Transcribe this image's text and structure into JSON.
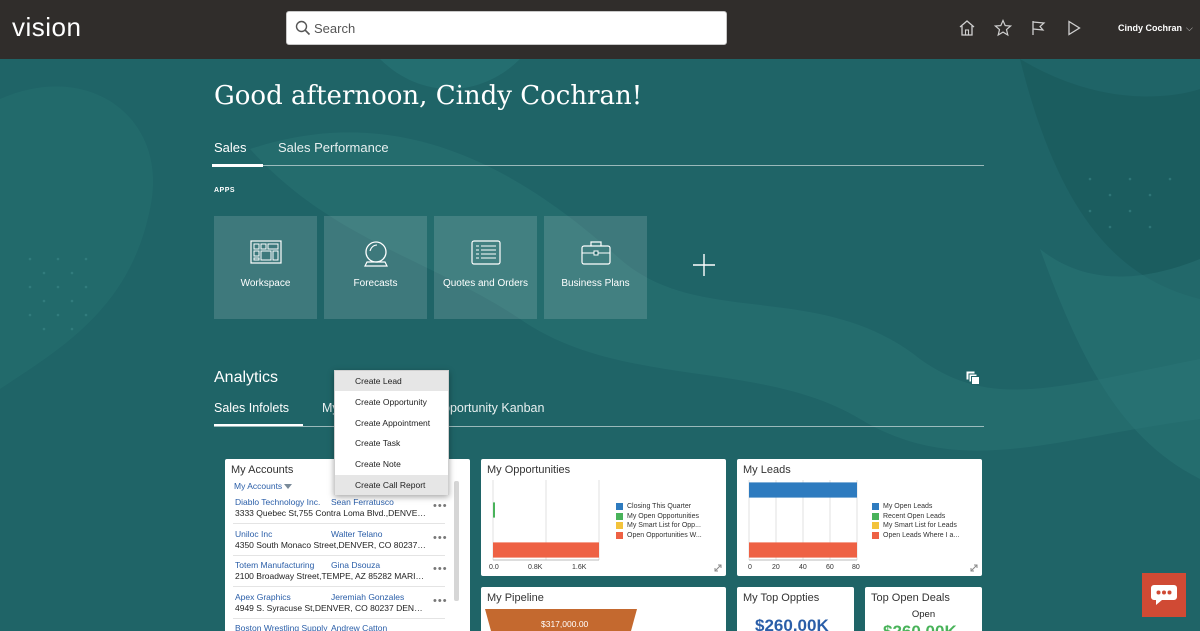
{
  "header": {
    "logo": "vision",
    "search_placeholder": "Search",
    "icons": [
      "home-icon",
      "star-icon",
      "flag-icon",
      "play-icon"
    ],
    "user_name": "Cindy Cochran",
    "user_chevron": "⌵"
  },
  "greeting": "Good afternoon, Cindy Cochran!",
  "tabs": [
    {
      "label": "Sales",
      "active": true
    },
    {
      "label": "Sales Performance",
      "active": false
    }
  ],
  "apps": {
    "label": "APPS",
    "items": [
      {
        "label": "Workspace",
        "icon": "workspace-icon"
      },
      {
        "label": "Forecasts",
        "icon": "forecasts-icon"
      },
      {
        "label": "Quotes and Orders",
        "icon": "quotes-icon"
      },
      {
        "label": "Business Plans",
        "icon": "briefcase-icon"
      }
    ]
  },
  "analytics": {
    "title": "Analytics",
    "tabs": [
      {
        "label": "Sales Infolets",
        "active": true
      },
      {
        "label": "My",
        "active": false
      },
      {
        "label": "pportunity Kanban",
        "active": false
      }
    ]
  },
  "menu": {
    "items": [
      {
        "label": "Create Lead",
        "highlighted": true
      },
      {
        "label": "Create Opportunity",
        "highlighted": false
      },
      {
        "label": "Create Appointment",
        "highlighted": false
      },
      {
        "label": "Create Task",
        "highlighted": false
      },
      {
        "label": "Create Note",
        "highlighted": false
      },
      {
        "label": "Create Call Report",
        "highlighted": true
      }
    ]
  },
  "cards": {
    "accounts": {
      "title": "My Accounts",
      "filter": "My Accounts",
      "rows": [
        {
          "name": "Diablo Technology Inc.",
          "contact": "Sean Ferratusco",
          "address": "3333 Quebec St,755 Contra Loma Blvd.,DENVER,CO 80"
        },
        {
          "name": "Uniloc Inc",
          "contact": "Walter Telano",
          "address": "4350 South Monaco Street,DENVER, CO 80237 US"
        },
        {
          "name": "Totem Manufacturing",
          "contact": "Gina Dsouza",
          "address": "2100 Broadway Street,TEMPE, AZ 85282 MARICOPA US"
        },
        {
          "name": "Apex Graphics",
          "contact": "Jeremiah Gonzales",
          "address": "4949 S. Syracuse St,DENVER, CO 80237 DENVER"
        },
        {
          "name": "Boston Wrestling Supply",
          "contact": "Andrew Catton",
          "address": ""
        }
      ],
      "more": "•••"
    },
    "opportunities": {
      "title": "My Opportunities"
    },
    "leads": {
      "title": "My Leads"
    },
    "pipeline": {
      "title": "My Pipeline",
      "funnel_value": "$317,000.00"
    },
    "top_oppties": {
      "title": "My Top Oppties",
      "value": "$260.00K"
    },
    "top_deals": {
      "title": "Top Open Deals",
      "subtitle": "Open",
      "value": "$260.00K"
    }
  },
  "colors": {
    "header": "#302d2b",
    "background": "#1f6467",
    "blue": "#2e7bbf",
    "green": "#49b35a",
    "yellow": "#f3c33c",
    "orange": "#ee6144",
    "pipeline": "#c4692f",
    "chat": "#d04a34"
  },
  "chart_data": [
    {
      "type": "bar",
      "orientation": "horizontal",
      "categories": [
        "Closing This Quarter",
        "My Open Opportunities",
        "My Smart List for Opp...",
        "Open Opportunities W..."
      ],
      "values": [
        0,
        20,
        0,
        2000
      ],
      "series": [
        {
          "name": "Closing This Quarter"
        },
        {
          "name": "My Open Opportunities"
        },
        {
          "name": "My Smart List for Opp..."
        },
        {
          "name": "Open Opportunities W..."
        }
      ],
      "xlim": [
        0,
        2000
      ],
      "ticks": [
        "0.0",
        "0.8K",
        "1.6K"
      ],
      "legend": "right"
    },
    {
      "type": "bar",
      "orientation": "horizontal",
      "categories": [
        "My Open Leads",
        "Recent Open Leads",
        "My Smart List for Leads",
        "Open Leads Where I a..."
      ],
      "values": [
        100,
        0,
        0,
        100
      ],
      "series": [
        {
          "name": "My Open Leads"
        },
        {
          "name": "Recent Open Leads"
        },
        {
          "name": "My Smart List for Leads"
        },
        {
          "name": "Open Leads Where I a..."
        }
      ],
      "xlim": [
        0,
        80
      ],
      "ticks": [
        "0",
        "20",
        "40",
        "60",
        "80"
      ],
      "legend": "right"
    }
  ]
}
